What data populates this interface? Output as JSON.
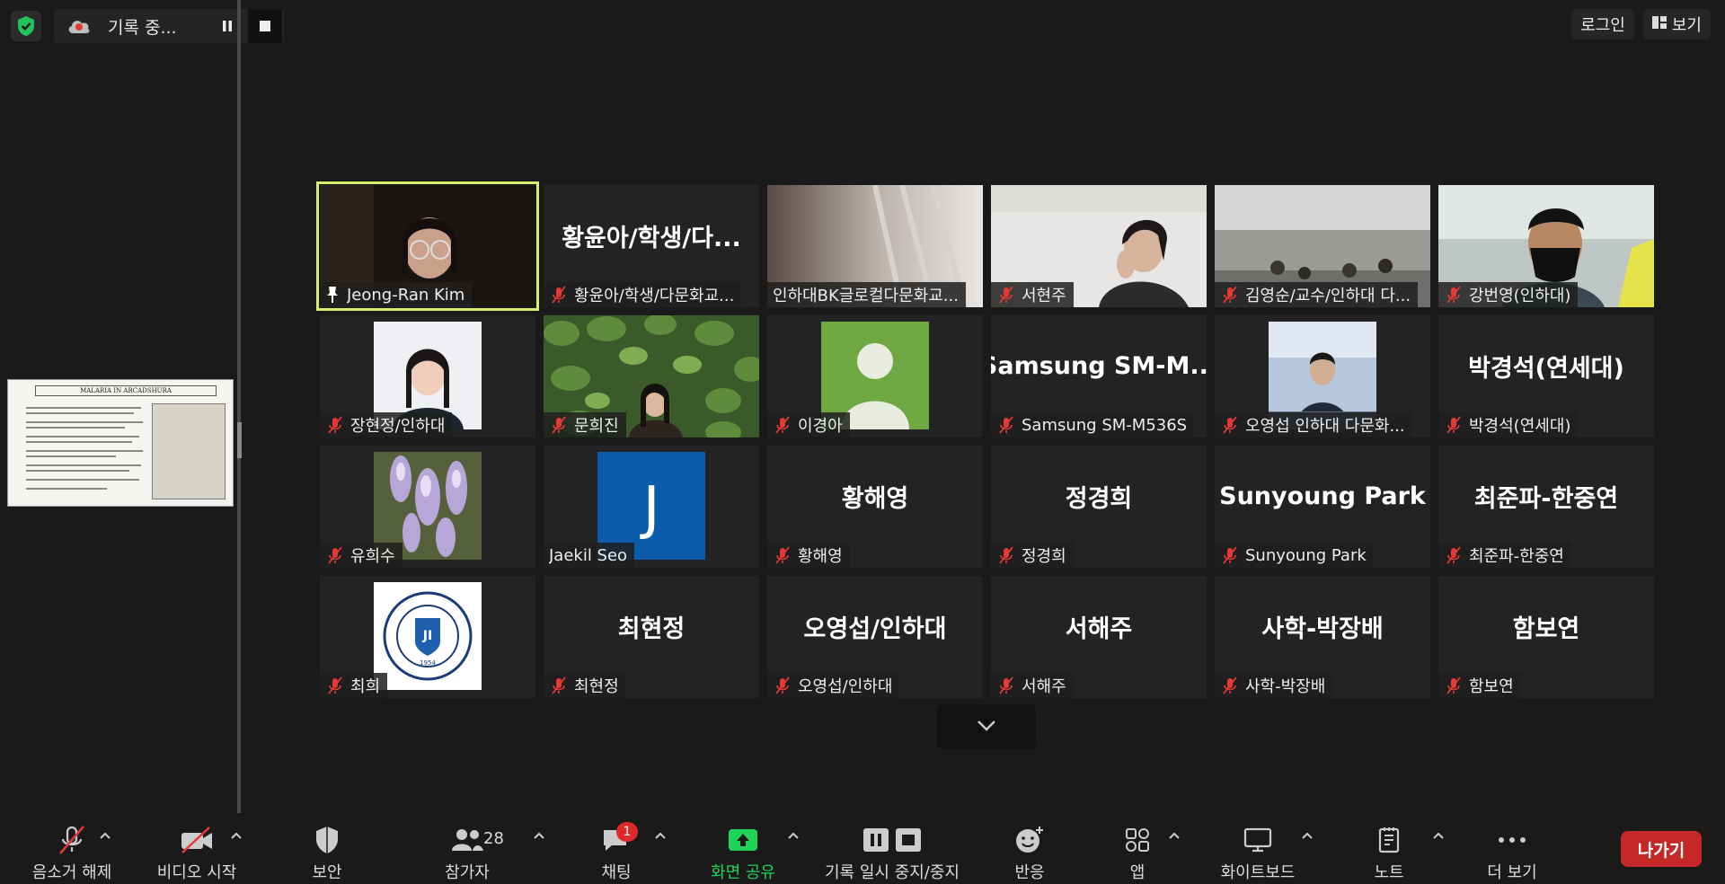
{
  "recording": {
    "status": "기록 중..."
  },
  "top_right": {
    "login": "로그인",
    "view": "보기"
  },
  "shared_doc": {
    "title": "MALARIA IN ARCADSHURA"
  },
  "participants": [
    {
      "name": "Jeong-Ran Kim",
      "label": "",
      "type": "video-woman",
      "pinned": true,
      "muted": false,
      "active": true
    },
    {
      "name": "황윤아/학생/다문화교...",
      "label": "황윤아/학생/다...",
      "type": "name",
      "muted": true
    },
    {
      "name": "인하대BK글로컬다문화교...",
      "label": "",
      "type": "video-room",
      "muted": false
    },
    {
      "name": "서현주",
      "label": "",
      "type": "video-woman2",
      "muted": true
    },
    {
      "name": "김영순/교수/인하대 다...",
      "label": "",
      "type": "video-hall",
      "muted": true
    },
    {
      "name": "강번영(인하대)",
      "label": "",
      "type": "video-man",
      "muted": true
    },
    {
      "name": "장현정/인하대",
      "label": "",
      "type": "photo-portrait",
      "muted": true
    },
    {
      "name": "문희진",
      "label": "",
      "type": "photo-leaves",
      "muted": true
    },
    {
      "name": "이경아",
      "label": "",
      "type": "photo-avatar",
      "muted": true
    },
    {
      "name": "Samsung SM-M536S",
      "label": "Samsung  SM-M...",
      "type": "name",
      "muted": true
    },
    {
      "name": "오영섭 인하대 다문화...",
      "label": "",
      "type": "photo-presenter",
      "muted": true
    },
    {
      "name": "박경석(연세대)",
      "label": "박경석(연세대)",
      "type": "name",
      "muted": true
    },
    {
      "name": "유희수",
      "label": "",
      "type": "photo-wisteria",
      "muted": true
    },
    {
      "name": "Jaekil Seo",
      "label": "J",
      "type": "photo-initial",
      "muted": false
    },
    {
      "name": "황해영",
      "label": "황해영",
      "type": "name",
      "muted": true
    },
    {
      "name": "정경희",
      "label": "정경희",
      "type": "name",
      "muted": true
    },
    {
      "name": "Sunyoung Park",
      "label": "Sunyoung Park",
      "type": "name",
      "muted": true
    },
    {
      "name": "최준파-한중연",
      "label": "최준파-한중연",
      "type": "name",
      "muted": true
    },
    {
      "name": "최희",
      "label": "",
      "type": "photo-logo",
      "muted": true
    },
    {
      "name": "최현정",
      "label": "최현정",
      "type": "name",
      "muted": true
    },
    {
      "name": "오영섭/인하대",
      "label": "오영섭/인하대",
      "type": "name",
      "muted": true
    },
    {
      "name": "서해주",
      "label": "서해주",
      "type": "name",
      "muted": true
    },
    {
      "name": "사학-박장배",
      "label": "사학-박장배",
      "type": "name",
      "muted": true
    },
    {
      "name": "함보연",
      "label": "함보연",
      "type": "name",
      "muted": true
    }
  ],
  "toolbar": {
    "unmute": "음소거 해제",
    "start_video": "비디오 시작",
    "security": "보안",
    "participants": "참가자",
    "participants_count": "28",
    "chat": "채팅",
    "chat_badge": "1",
    "share": "화면 공유",
    "record": "기록 일시 중지/중지",
    "reactions": "반응",
    "apps": "앱",
    "whiteboard": "화이트보드",
    "notes": "노트",
    "more": "더 보기",
    "leave": "나가기"
  },
  "colors": {
    "active_speaker": "#d6ef6f",
    "share_green": "#1fd35a",
    "leave_red": "#c62828",
    "badge_red": "#e02828"
  }
}
